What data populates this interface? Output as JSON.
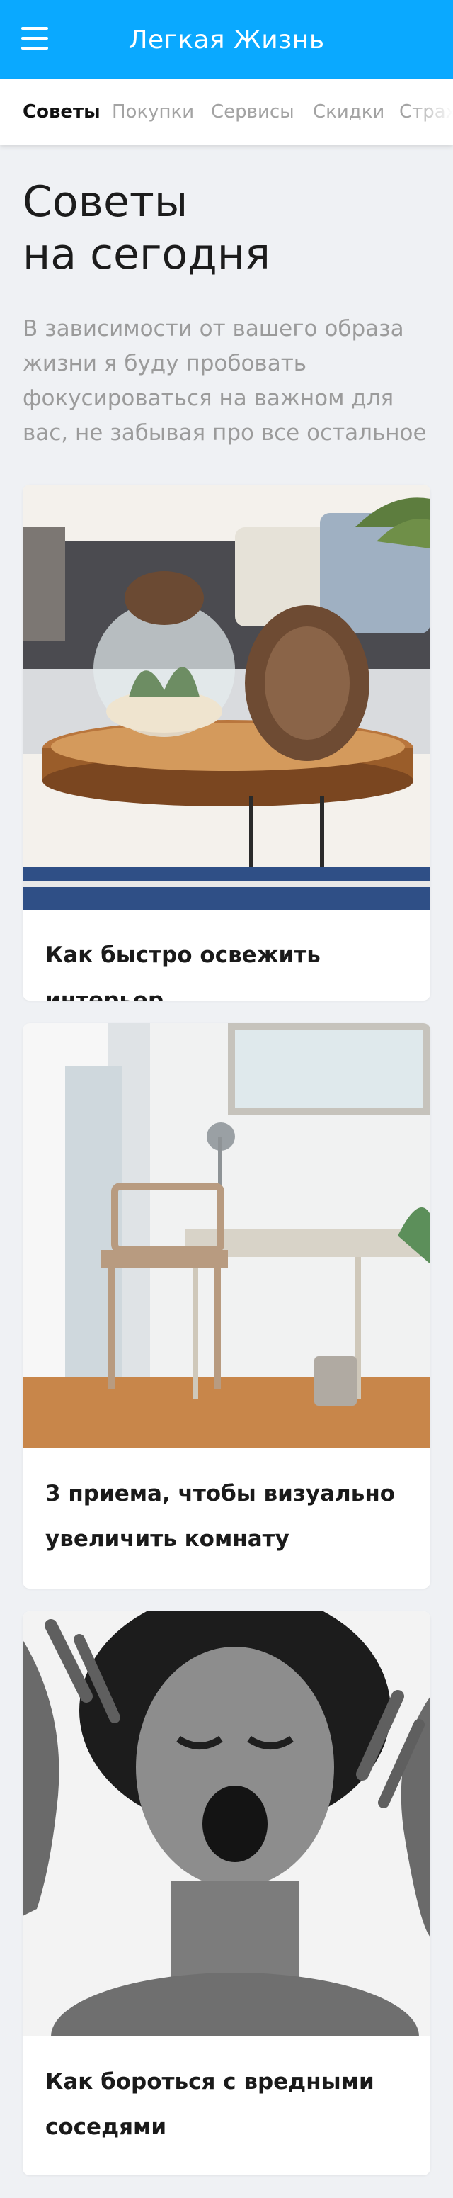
{
  "header": {
    "title": "Легкая Жизнь",
    "menu_icon": "hamburger-menu-icon",
    "background_color": "#0aa9ff"
  },
  "tabs": [
    {
      "label": "Советы",
      "active": true
    },
    {
      "label": "Покупки",
      "active": false
    },
    {
      "label": "Сервисы",
      "active": false
    },
    {
      "label": "Скидки",
      "active": false
    },
    {
      "label": "Страхо",
      "active": false
    }
  ],
  "main": {
    "title": "Советы\nна сегодня",
    "subtitle": "В зависимости от вашего образа жизни я буду пробовать фокусироваться на важном для вас, не забывая про все остальное"
  },
  "articles": [
    {
      "title": "Как быстро освежить интерьер",
      "image": "living-room-table-with-pinecone-and-terrarium"
    },
    {
      "title": "3 приема, чтобы визуально увеличить комнату",
      "image": "bright-room-with-desk-and-chair"
    },
    {
      "title": "Как бороться с вредными соседями",
      "image": "screaming-woman-black-and-white"
    }
  ]
}
